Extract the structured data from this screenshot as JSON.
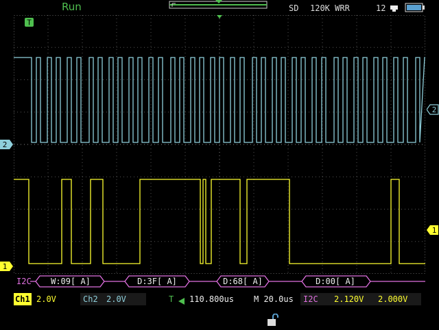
{
  "status": {
    "run_state": "Run",
    "storage": "SD",
    "memory": "120K",
    "memory_mode": "WRR",
    "clock": "12"
  },
  "ch1": {
    "label": "Ch1",
    "volts": "2.0V",
    "color": "#ffff30"
  },
  "ch2": {
    "label": "Ch2",
    "volts": "2.0V",
    "color": "#8fd0dc"
  },
  "markers": {
    "trigger": "T",
    "ch1": "1",
    "ch2": "2"
  },
  "decode": {
    "protocol": "I2C",
    "packets": [
      "W:09[ A]",
      "D:3F[ A]",
      "D:68[ A]",
      "D:00[ A]"
    ],
    "color": "#e070e0"
  },
  "timebase": {
    "delay": "110.800us",
    "scale": "M 20.0us"
  },
  "trigger": {
    "source": "I2C",
    "level1": "2.120V",
    "level2": "2.000V"
  },
  "icons": {
    "usb": "usb-icon",
    "battery": "battery-icon",
    "lock": "unlock-icon"
  }
}
